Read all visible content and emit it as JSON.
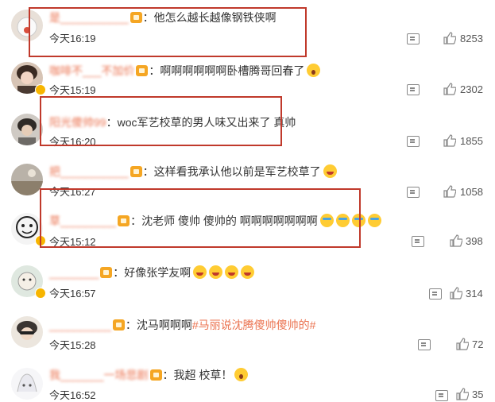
{
  "comments": [
    {
      "username": "是___________",
      "content": "他怎么越长越像钢铁侠啊",
      "emojis": [],
      "time": "今天16:19",
      "likes": "8253"
    },
    {
      "username": "咖啡不___不加价",
      "content": "啊啊啊啊啊啊卧槽腾哥回春了",
      "emojis": [
        "surprise"
      ],
      "time": "今天15:19",
      "likes": "2302"
    },
    {
      "username": "阳光傻帅99",
      "content": "woc军艺校草的男人味又出来了 真帅",
      "emojis": [],
      "time": "今天16:20",
      "likes": "1855"
    },
    {
      "username": "把___________",
      "content": "这样看我承认他以前是军艺校草了",
      "emojis": [
        "laugh"
      ],
      "time": "今天16:27",
      "likes": "1058"
    },
    {
      "username": "草_________",
      "content": "沈老师 傻帅 傻帅的 啊啊啊啊啊啊啊",
      "emojis": [
        "cry",
        "cry",
        "cry",
        "cry"
      ],
      "time": "今天15:12",
      "likes": "398"
    },
    {
      "username": "________",
      "content": "好像张学友啊",
      "emojis": [
        "laugh",
        "laugh",
        "laugh",
        "laugh"
      ],
      "time": "今天16:57",
      "likes": "314"
    },
    {
      "username": "__________",
      "content": "沈马啊啊啊",
      "topic": "#马丽说沈腾傻帅傻帅的#",
      "emojis": [],
      "time": "今天15:28",
      "likes": "72"
    },
    {
      "username": "我_______一场悲剧",
      "content": "我超 校草！",
      "emojis": [
        "surprise"
      ],
      "time": "今天16:52",
      "likes": "35"
    }
  ],
  "colors": {
    "username": "#eb7350",
    "highlight_box": "#c0392b",
    "badge": "#f5a623"
  },
  "icons": {
    "reply": "comment-icon",
    "like": "thumbs-up-icon",
    "fan": "fan-badge-icon",
    "verified": "verified-badge-icon"
  }
}
